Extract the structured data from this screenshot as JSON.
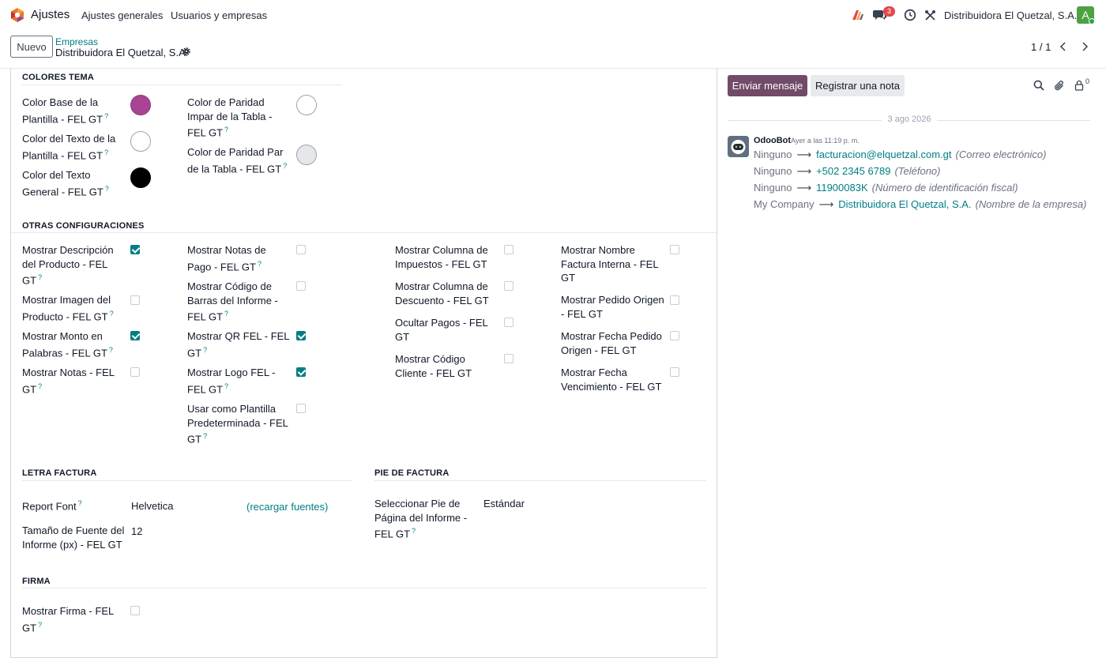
{
  "navbar": {
    "app_name": "Ajustes",
    "menu": [
      "Ajustes generales",
      "Usuarios y empresas"
    ],
    "messages_badge": "3",
    "company": "Distribuidora El Quetzal, S.A.",
    "avatar_letter": "A"
  },
  "control": {
    "new_button": "Nuevo",
    "breadcrumb_parent": "Empresas",
    "breadcrumb_current": "Distribuidora El Quetzal, S.A.",
    "pager": "1 / 1"
  },
  "form": {
    "help_mark": "?",
    "colores": {
      "title": "COLORES TEMA",
      "left": [
        {
          "label1": "Color Base de la",
          "label2": "Plantilla - FEL GT",
          "color": "#a94495"
        },
        {
          "label1": "Color del Texto de la",
          "label2": "Plantilla - FEL GT",
          "color": "#ffffff"
        },
        {
          "label1": "Color del Texto",
          "label2": "General - FEL GT",
          "color": "#000000"
        }
      ],
      "right": [
        {
          "label1": "Color de Paridad",
          "label2": "Impar de la Tabla -",
          "label3": "FEL GT",
          "color": "#ffffff"
        },
        {
          "label1": "Color de Paridad Par",
          "label2": "de la Tabla - FEL GT",
          "color": "#e5e7eb"
        }
      ]
    },
    "otras": {
      "title": "OTRAS CONFIGURACIONES",
      "col1": [
        {
          "lines": [
            "Mostrar Descripción",
            "del Producto - FEL",
            "GT"
          ],
          "checked": true
        },
        {
          "lines": [
            "Mostrar Imagen del",
            "Producto - FEL GT"
          ],
          "checked": false
        },
        {
          "lines": [
            "Mostrar Monto en",
            "Palabras - FEL GT"
          ],
          "checked": true
        },
        {
          "lines": [
            "Mostrar Notas - FEL",
            "GT"
          ],
          "checked": false
        }
      ],
      "col2": [
        {
          "lines": [
            "Mostrar Notas de",
            "Pago - FEL GT"
          ],
          "checked": false
        },
        {
          "lines": [
            "Mostrar Código de",
            "Barras del Informe -",
            "FEL GT"
          ],
          "checked": false
        },
        {
          "lines": [
            "Mostrar QR FEL - FEL",
            "GT"
          ],
          "checked": true
        },
        {
          "lines": [
            "Mostrar Logo FEL -",
            "FEL GT"
          ],
          "checked": true
        },
        {
          "lines": [
            "Usar como Plantilla",
            "Predeterminada - FEL",
            "GT"
          ],
          "checked": false
        }
      ],
      "col3": [
        {
          "lines": [
            "Mostrar Columna de",
            "Impuestos - FEL GT"
          ],
          "checked": false
        },
        {
          "lines": [
            "Mostrar Columna de",
            "Descuento - FEL GT"
          ],
          "checked": false
        },
        {
          "lines": [
            "Ocultar Pagos - FEL",
            "GT"
          ],
          "checked": false
        },
        {
          "lines": [
            "Mostrar Código",
            "Cliente - FEL GT"
          ],
          "checked": false
        }
      ],
      "col4": [
        {
          "lines": [
            "Mostrar Nombre",
            "Factura Interna - FEL",
            "GT"
          ],
          "checked": false
        },
        {
          "lines": [
            "Mostrar Pedido Origen",
            "- FEL GT"
          ],
          "checked": false
        },
        {
          "lines": [
            "Mostrar Fecha Pedido",
            "Origen - FEL GT"
          ],
          "checked": false
        },
        {
          "lines": [
            "Mostrar Fecha",
            "Vencimiento - FEL GT"
          ],
          "checked": false
        }
      ]
    },
    "letra": {
      "title": "LETRA FACTURA",
      "report_font_label": "Report Font",
      "report_font_value": "Helvetica",
      "reload_fonts": "(recargar fuentes)",
      "font_size_label1": "Tamaño de Fuente del",
      "font_size_label2": "Informe (px) - FEL GT",
      "font_size_value": "12"
    },
    "pie": {
      "title": "PIE DE FACTURA",
      "label1": "Seleccionar Pie de",
      "label2": "Página del Informe -",
      "label3": "FEL GT",
      "value": "Estándar"
    },
    "firma": {
      "title": "FIRMA",
      "label1": "Mostrar Firma - FEL",
      "label2": "GT",
      "checked": false
    }
  },
  "chatter": {
    "send_button": "Enviar mensaje",
    "note_button": "Registrar una nota",
    "followers": "0",
    "date": "3 ago 2026",
    "author": "OdooBot",
    "time": "Ayer a las 11:19 p. m.",
    "tracking": [
      {
        "old": "Ninguno",
        "new": "facturacion@elquetzal.com.gt",
        "field": "(Correo electrónico)"
      },
      {
        "old": "Ninguno",
        "new": "+502 2345 6789",
        "field": "(Teléfono)"
      },
      {
        "old": "Ninguno",
        "new": "11900083K",
        "field": "(Número de identificación fiscal)"
      },
      {
        "old": "My Company",
        "new": "Distribuidora El Quetzal, S.A.",
        "field": "(Nombre de la empresa)"
      }
    ]
  }
}
